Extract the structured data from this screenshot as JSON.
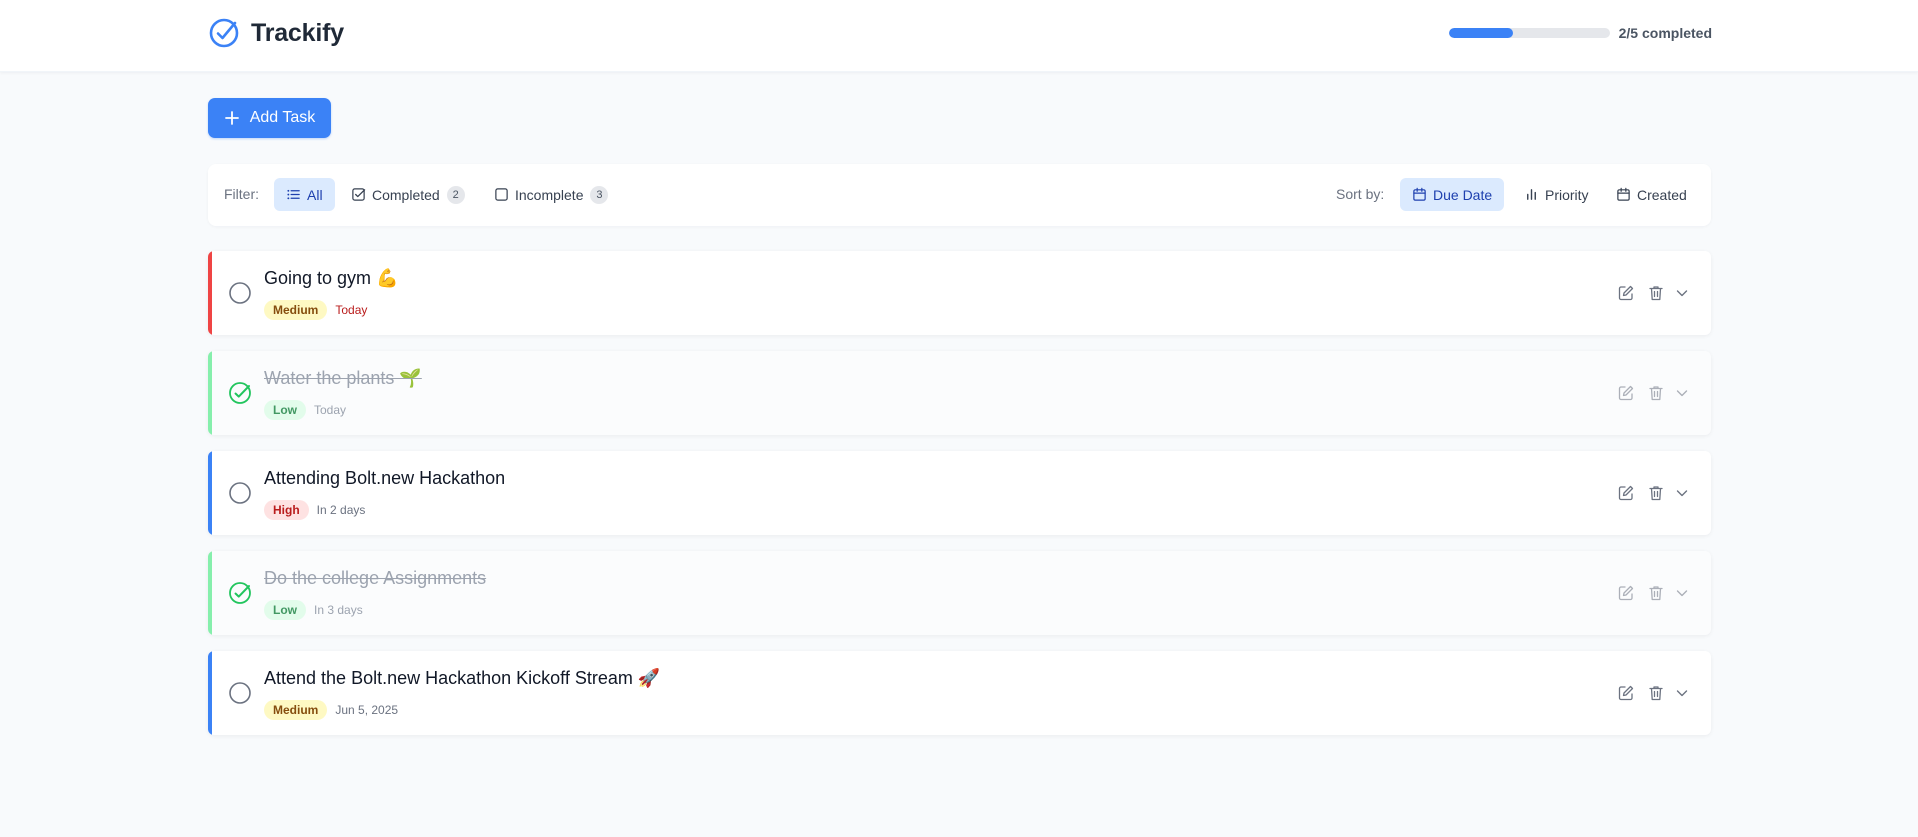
{
  "header": {
    "app_name": "Trackify",
    "progress_text": "2/5 completed",
    "progress_fraction": 0.4,
    "accent_color": "#3b82f6"
  },
  "add_button": {
    "label": "Add Task"
  },
  "filter": {
    "label": "Filter:",
    "options": [
      {
        "label": "All",
        "active": true,
        "icon": "list-icon"
      },
      {
        "label": "Completed",
        "count": "2",
        "icon": "checkbox-checked-icon"
      },
      {
        "label": "Incomplete",
        "count": "3",
        "icon": "checkbox-empty-icon"
      }
    ]
  },
  "sort": {
    "label": "Sort by:",
    "options": [
      {
        "label": "Due Date",
        "active": true,
        "icon": "calendar-icon"
      },
      {
        "label": "Priority",
        "icon": "bar-chart-icon"
      },
      {
        "label": "Created",
        "icon": "calendar-icon"
      }
    ]
  },
  "tasks": [
    {
      "title": "Going to gym 💪",
      "priority": "Medium",
      "due": "Today",
      "completed": false,
      "accent": "#ef4444"
    },
    {
      "title": "Water the plants 🌱",
      "priority": "Low",
      "due": "Today",
      "completed": true,
      "accent": "#86efac"
    },
    {
      "title": "Attending Bolt.new Hackathon",
      "priority": "High",
      "due": "In 2 days",
      "completed": false,
      "accent": "#3b82f6"
    },
    {
      "title": "Do the college Assignments",
      "priority": "Low",
      "due": "In 3 days",
      "completed": true,
      "accent": "#86efac"
    },
    {
      "title": "Attend the Bolt.new Hackathon Kickoff Stream 🚀",
      "priority": "Medium",
      "due": "Jun 5, 2025",
      "completed": false,
      "accent": "#3b82f6"
    }
  ]
}
